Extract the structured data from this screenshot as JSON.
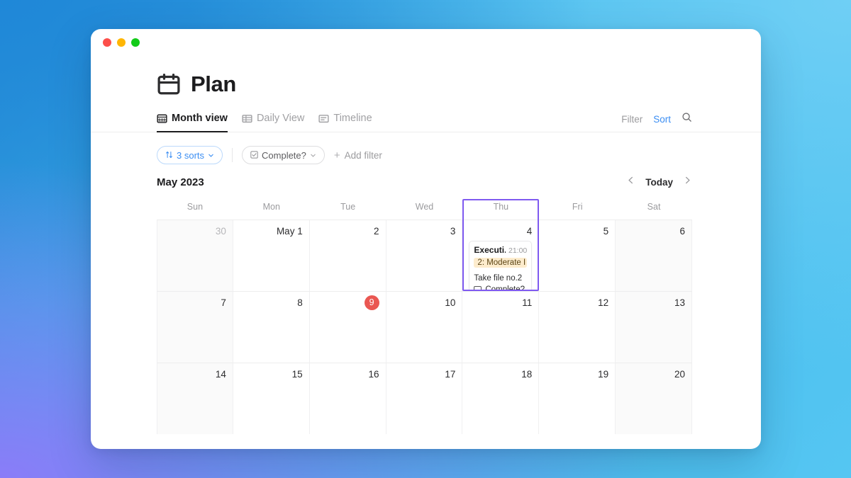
{
  "window": {
    "traffic_lights": [
      "close",
      "minimize",
      "zoom"
    ],
    "colors": {
      "close": "#fc4f4a",
      "minimize": "#ffb604",
      "zoom": "#13cb19"
    }
  },
  "header": {
    "icon": "calendar-icon",
    "title": "Plan"
  },
  "tabs": [
    {
      "label": "Month view",
      "icon": "calendar-grid-icon",
      "active": true
    },
    {
      "label": "Daily View",
      "icon": "table-icon",
      "active": false
    },
    {
      "label": "Timeline",
      "icon": "timeline-icon",
      "active": false
    }
  ],
  "tools": {
    "filter_label": "Filter",
    "sort_label": "Sort",
    "search_icon": "search-icon",
    "accent_color": "#3b8ef3"
  },
  "filter_bar": {
    "sorts_chip": {
      "label": "3 sorts",
      "icon": "sort-arrows-icon",
      "caret": "chevron-down-icon"
    },
    "property_chip": {
      "label": "Complete?",
      "icon": "checkbox-checked-icon",
      "caret": "chevron-down-icon"
    },
    "add_filter_label": "Add filter"
  },
  "calendar": {
    "month_label": "May 2023",
    "today_label": "Today",
    "prev_icon": "chevron-left-icon",
    "next_icon": "chevron-right-icon",
    "weekdays": [
      "Sun",
      "Mon",
      "Tue",
      "Wed",
      "Thu",
      "Fri",
      "Sat"
    ],
    "highlight_color": "#7f5af0",
    "today_badge_color": "#ea5752",
    "highlighted_column": "Thu",
    "weeks": [
      [
        {
          "num": "30",
          "muted": true
        },
        {
          "num": "May 1",
          "muted": false
        },
        {
          "num": "2",
          "muted": false
        },
        {
          "num": "3",
          "muted": false
        },
        {
          "num": "4",
          "muted": false,
          "event": {
            "title": "Executi...",
            "time": "21:00",
            "badge": "2: Moderate I",
            "badge_bg": "#fdeccd",
            "note": "Take file no.2",
            "checkbox_label": "Complete?",
            "checked": false
          }
        },
        {
          "num": "5",
          "muted": false
        },
        {
          "num": "6",
          "muted": false
        }
      ],
      [
        {
          "num": "7",
          "muted": false
        },
        {
          "num": "8",
          "muted": false
        },
        {
          "num": "9",
          "muted": false,
          "today": true
        },
        {
          "num": "10",
          "muted": false
        },
        {
          "num": "11",
          "muted": false
        },
        {
          "num": "12",
          "muted": false
        },
        {
          "num": "13",
          "muted": false
        }
      ],
      [
        {
          "num": "14",
          "muted": false
        },
        {
          "num": "15",
          "muted": false
        },
        {
          "num": "16",
          "muted": false
        },
        {
          "num": "17",
          "muted": false
        },
        {
          "num": "18",
          "muted": false
        },
        {
          "num": "19",
          "muted": false
        },
        {
          "num": "20",
          "muted": false
        }
      ]
    ]
  }
}
